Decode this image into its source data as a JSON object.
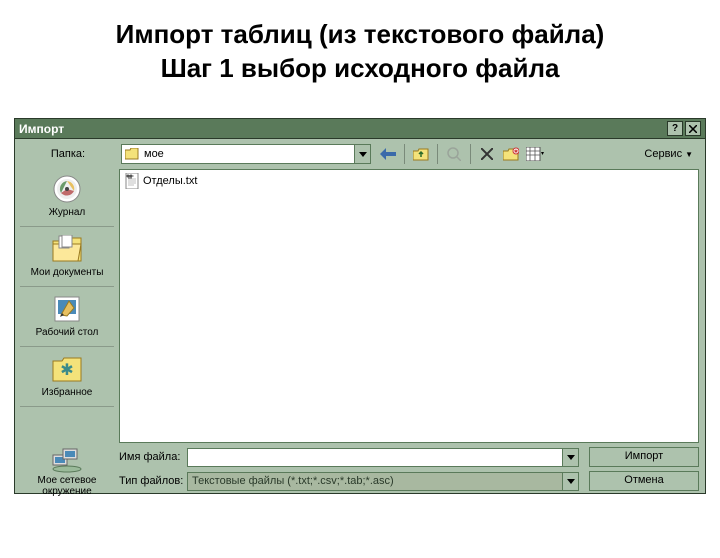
{
  "slide": {
    "title_line1": "Импорт таблиц (из текстового файла)",
    "title_line2": "Шаг 1 выбор исходного файла"
  },
  "dialog": {
    "title": "Импорт",
    "folder_label": "Папка:",
    "folder_value": "мое",
    "service_label": "Сервис",
    "file_list": {
      "items": [
        {
          "name": "Отделы.txt"
        }
      ]
    },
    "sidebar": {
      "items": [
        {
          "label": "Журнал",
          "icon": "history-icon"
        },
        {
          "label": "Мои документы",
          "icon": "my-documents-icon"
        },
        {
          "label": "Рабочий стол",
          "icon": "desktop-icon"
        },
        {
          "label": "Избранное",
          "icon": "favorites-icon"
        },
        {
          "label": "Мое сетевое окружение",
          "icon": "network-icon"
        }
      ]
    },
    "filename_label": "Имя файла:",
    "filename_value": "",
    "filetype_label": "Тип файлов:",
    "filetype_value": "Текстовые файлы (*.txt;*.csv;*.tab;*.asc)",
    "buttons": {
      "import": "Импорт",
      "cancel": "Отмена"
    }
  }
}
